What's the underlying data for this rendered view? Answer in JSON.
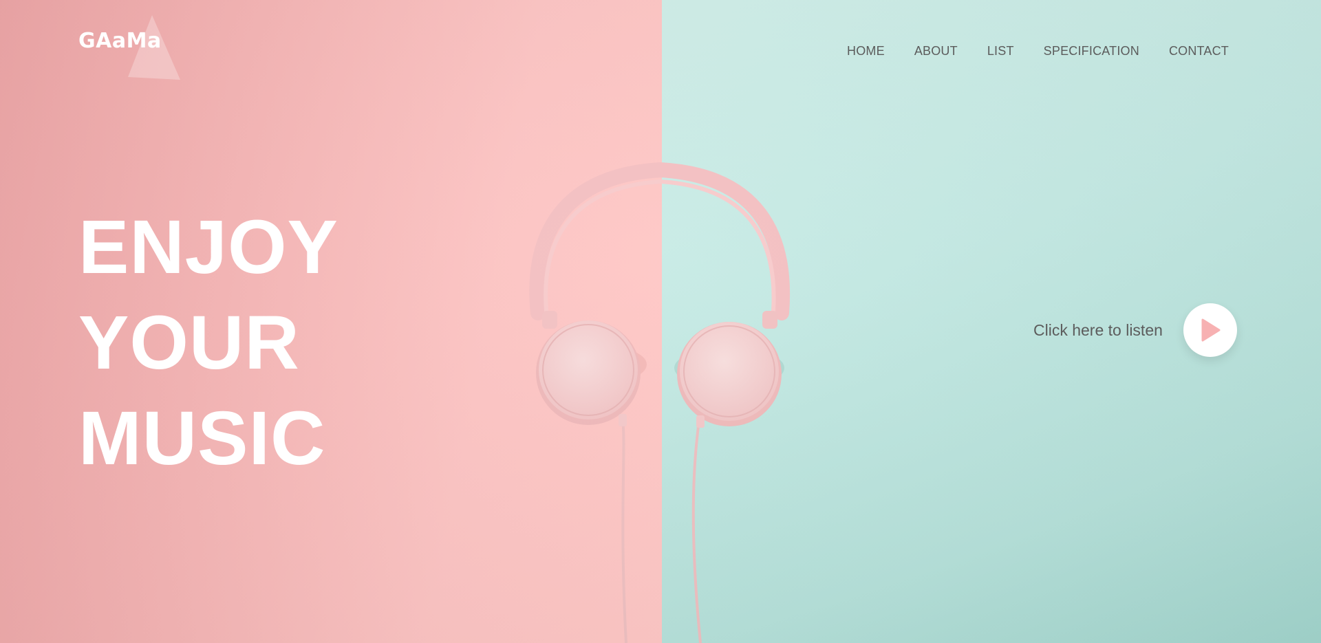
{
  "brand": {
    "logo_text": "GAaMa"
  },
  "nav": {
    "items": [
      {
        "label": "HOME"
      },
      {
        "label": "ABOUT"
      },
      {
        "label": "LIST"
      },
      {
        "label": "SPECIFICATION"
      },
      {
        "label": "CONTACT"
      }
    ]
  },
  "hero": {
    "lines": [
      "ENJOY",
      "YOUR",
      "MUSIC"
    ]
  },
  "listen": {
    "label": "Click here to listen",
    "icon": "play-icon"
  },
  "colors": {
    "left_background": "#f8b9b8",
    "right_background": "#c1e8e2",
    "text_light": "#ffffff",
    "text_dark": "#5b5b5b",
    "play_accent": "#f7b1b2"
  }
}
